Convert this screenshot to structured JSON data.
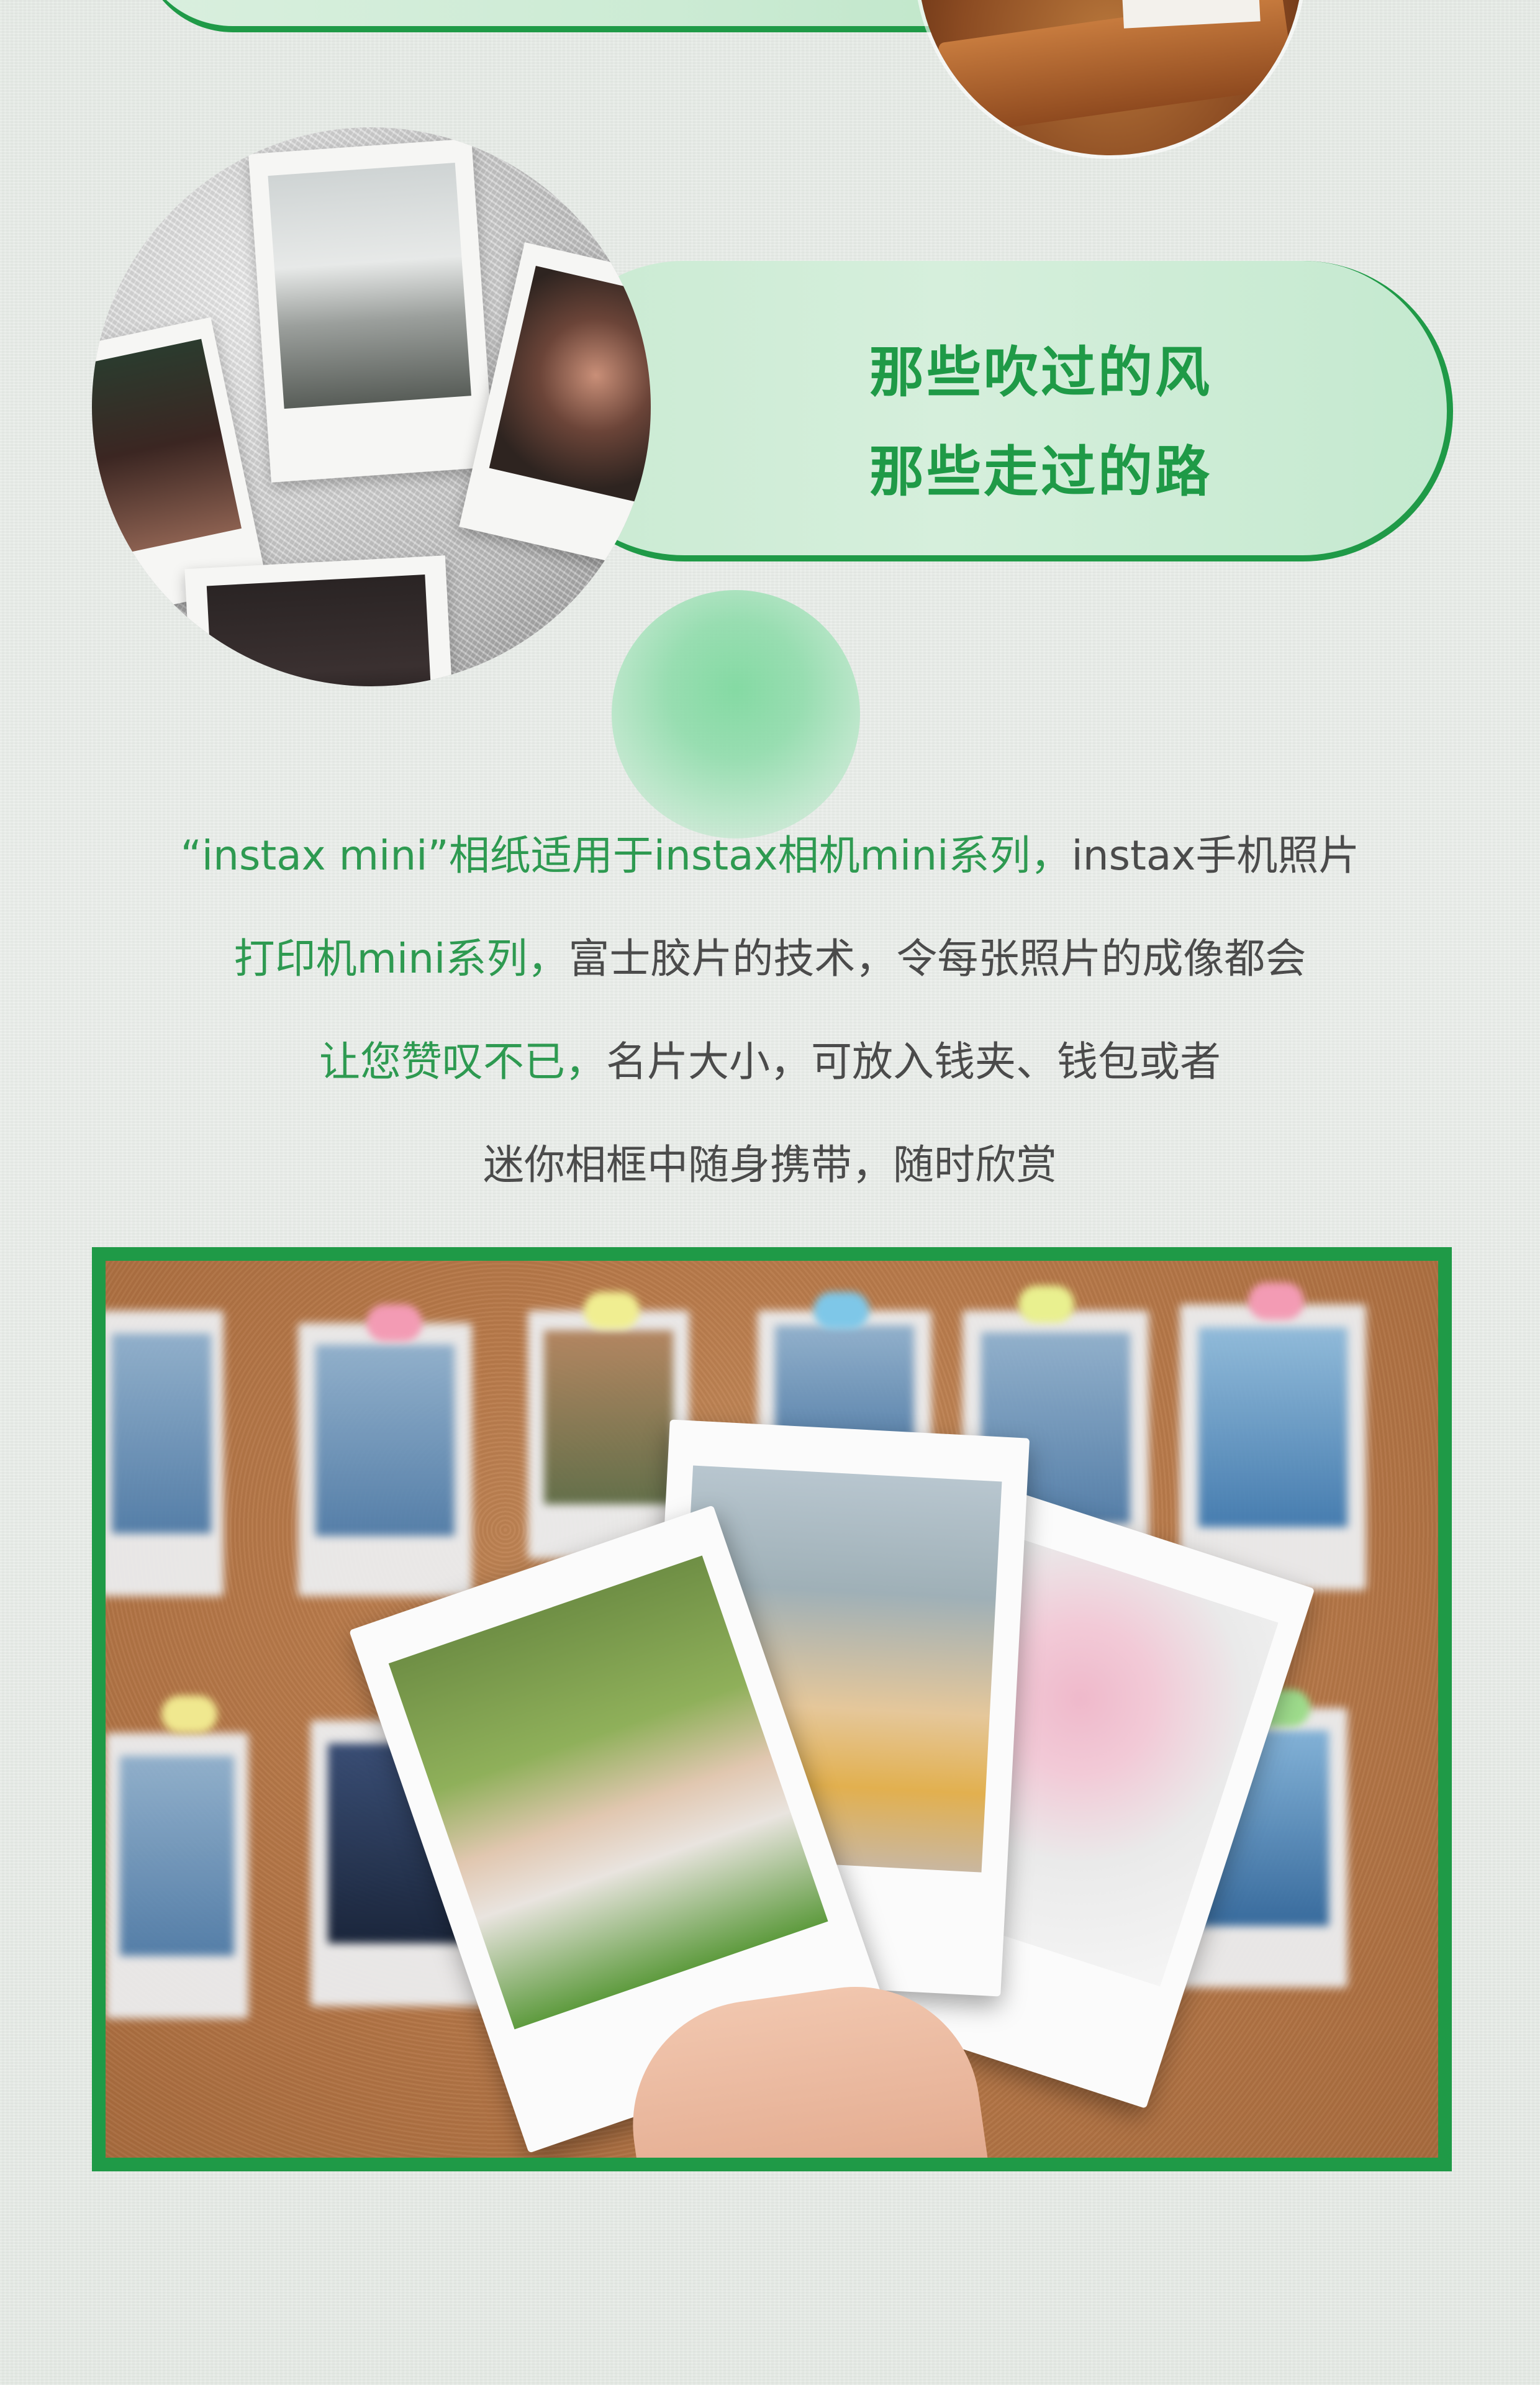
{
  "pill": {
    "line1": "那些吹过的风",
    "line2": "那些走过的路"
  },
  "description": {
    "line1_green": "“instax mini”相纸适用于instax相机mini系列，",
    "line1_gray": "instax手机照片",
    "line2_green": "打印机mini系列，",
    "line2_gray": "富士胶片的技术，令每张照片的成像都会",
    "line3_green": "让您赞叹不已，",
    "line3_gray": "名片大小，可放入钱夹、钱包或者",
    "line4": "迷你相框中随身携带，随时欣赏"
  },
  "colors": {
    "accent_green": "#1f9a47",
    "text_green": "#2e9a51",
    "text_gray": "#4b4b4b"
  }
}
